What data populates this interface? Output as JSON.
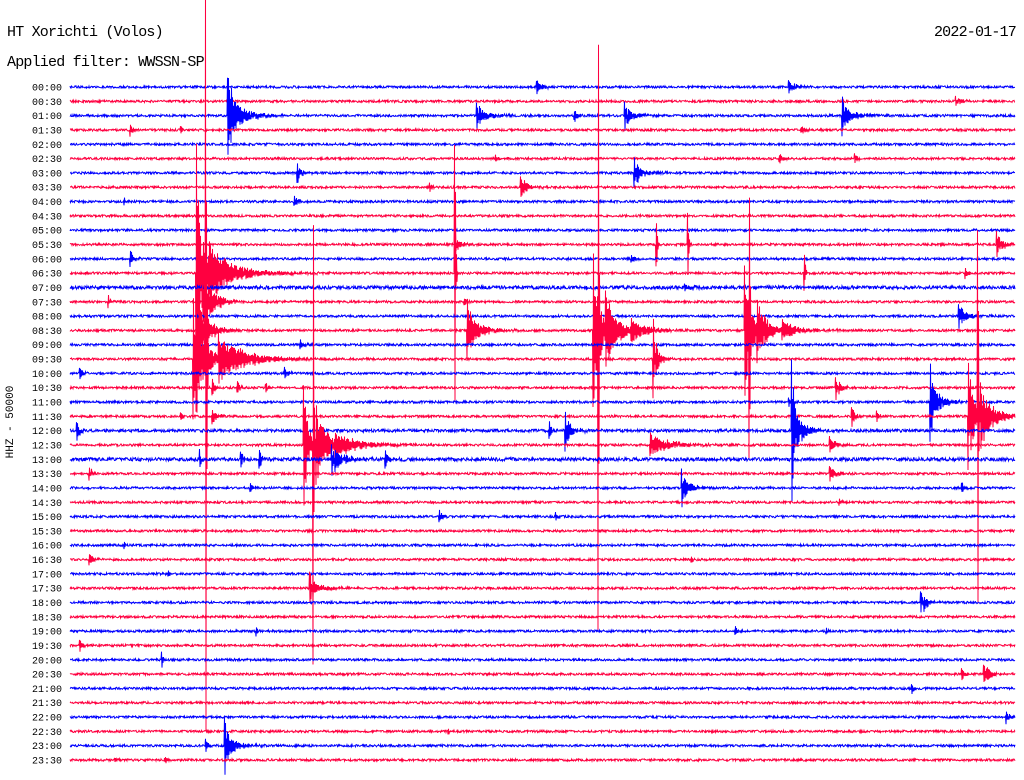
{
  "chart_data": {
    "type": "line",
    "title": "HT Xorichti (Volos)",
    "date": "2022-01-17",
    "subtitle": "Applied filter: WWSSN-SP",
    "ylabel": "HHZ - 50000",
    "xlabel": "",
    "xlim": [
      0,
      30
    ],
    "grid": false,
    "colors": [
      "#0000ff",
      "#ff0040"
    ],
    "noise": 0.08,
    "traces": [
      {
        "label": "00:00",
        "events": [
          [
            14.8,
            0.45,
            0.5
          ],
          [
            22.8,
            0.45,
            0.6
          ]
        ]
      },
      {
        "label": "00:30",
        "events": [
          [
            28.1,
            0.3,
            0.6
          ]
        ]
      },
      {
        "label": "01:00",
        "events": [
          [
            5.0,
            2.7,
            0.3
          ],
          [
            5.1,
            1.0,
            1.6
          ],
          [
            12.9,
            0.9,
            0.2
          ],
          [
            13.0,
            0.4,
            1.2
          ],
          [
            16.0,
            0.35,
            0.4
          ],
          [
            17.6,
            1.05,
            0.2
          ],
          [
            17.7,
            0.4,
            1.0
          ],
          [
            24.5,
            1.4,
            0.2
          ],
          [
            24.6,
            0.5,
            1.2
          ]
        ]
      },
      {
        "label": "01:30",
        "events": [
          [
            1.9,
            0.4,
            0.3
          ],
          [
            3.5,
            0.2,
            0.2
          ],
          [
            23.2,
            0.25,
            0.5
          ]
        ]
      },
      {
        "label": "02:00",
        "events": []
      },
      {
        "label": "02:30",
        "events": [
          [
            13.5,
            0.2,
            0.2
          ],
          [
            22.5,
            0.3,
            0.6
          ],
          [
            24.9,
            0.3,
            0.3
          ]
        ]
      },
      {
        "label": "03:00",
        "events": [
          [
            7.2,
            0.7,
            0.4
          ],
          [
            17.9,
            1.05,
            0.2
          ],
          [
            18.0,
            0.4,
            1.0
          ]
        ]
      },
      {
        "label": "03:30",
        "events": [
          [
            11.4,
            0.35,
            0.2
          ],
          [
            14.3,
            0.7,
            0.3
          ],
          [
            14.4,
            0.3,
            1.0
          ]
        ]
      },
      {
        "label": "04:00",
        "events": [
          [
            1.7,
            0.2,
            0.1
          ],
          [
            7.1,
            0.35,
            0.4
          ]
        ]
      },
      {
        "label": "04:30",
        "events": []
      },
      {
        "label": "05:00",
        "events": []
      },
      {
        "label": "05:30",
        "events": [
          [
            12.2,
            1.0,
            0.1
          ],
          [
            12.3,
            0.3,
            0.6
          ],
          [
            18.6,
            1.5,
            0.08
          ],
          [
            19.6,
            2.2,
            0.08
          ],
          [
            29.4,
            0.9,
            0.6
          ]
        ]
      },
      {
        "label": "06:00",
        "events": [
          [
            1.9,
            0.5,
            0.3
          ],
          [
            17.8,
            0.25,
            0.5
          ]
        ]
      },
      {
        "label": "06:30",
        "events": [
          [
            4.0,
            9.0,
            0.12
          ],
          [
            4.05,
            3.5,
            1.0
          ],
          [
            4.4,
            1.3,
            2.8
          ],
          [
            12.2,
            9.0,
            0.06
          ],
          [
            23.3,
            1.2,
            0.08
          ],
          [
            28.4,
            0.4,
            0.3
          ]
        ]
      },
      {
        "label": "07:00",
        "noise": 0.12,
        "events": [
          [
            19.5,
            0.25,
            1.0
          ]
        ]
      },
      {
        "label": "07:30",
        "events": [
          [
            1.2,
            0.4,
            0.2
          ],
          [
            4.2,
            2.0,
            1.0
          ],
          [
            12.5,
            0.25,
            0.3
          ]
        ]
      },
      {
        "label": "08:00",
        "events": [
          [
            28.2,
            0.85,
            0.2
          ],
          [
            28.3,
            0.35,
            0.8
          ]
        ]
      },
      {
        "label": "08:30",
        "events": [
          [
            4.1,
            2.0,
            1.0
          ],
          [
            12.6,
            2.2,
            0.25
          ],
          [
            12.7,
            0.8,
            1.3
          ],
          [
            16.75,
            19.0,
            0.05
          ],
          [
            16.6,
            5.3,
            0.6
          ],
          [
            17.0,
            2.0,
            1.2
          ],
          [
            17.8,
            0.6,
            1.5
          ],
          [
            21.55,
            8.0,
            0.06
          ],
          [
            21.4,
            4.5,
            0.6
          ],
          [
            21.8,
            1.8,
            1.0
          ],
          [
            22.6,
            0.6,
            1.5
          ]
        ]
      },
      {
        "label": "09:00",
        "events": [
          [
            7.3,
            0.35,
            0.3
          ]
        ]
      },
      {
        "label": "09:30",
        "events": [
          [
            3.9,
            4.2,
            0.2
          ],
          [
            4.0,
            3.0,
            1.0
          ],
          [
            4.3,
            25.0,
            0.05
          ],
          [
            4.7,
            1.5,
            2.6
          ],
          [
            18.5,
            2.8,
            0.12
          ],
          [
            18.6,
            0.8,
            0.5
          ]
        ]
      },
      {
        "label": "10:00",
        "events": [
          [
            0.3,
            0.45,
            0.3
          ],
          [
            6.8,
            0.4,
            0.3
          ]
        ]
      },
      {
        "label": "10:30",
        "events": [
          [
            4.5,
            0.6,
            0.2
          ],
          [
            5.3,
            0.4,
            0.2
          ],
          [
            6.2,
            0.3,
            0.2
          ],
          [
            24.3,
            0.8,
            0.2
          ],
          [
            24.4,
            0.3,
            0.6
          ]
        ]
      },
      {
        "label": "11:00",
        "events": [
          [
            22.8,
            0.3,
            0.3
          ],
          [
            27.3,
            2.7,
            0.12
          ],
          [
            27.35,
            1.1,
            1.0
          ]
        ]
      },
      {
        "label": "11:30",
        "events": [
          [
            3.5,
            0.3,
            0.2
          ],
          [
            4.5,
            0.5,
            0.5
          ],
          [
            24.8,
            0.7,
            0.3
          ],
          [
            25.6,
            0.4,
            0.2
          ],
          [
            28.8,
            12.5,
            0.05
          ],
          [
            28.5,
            3.8,
            0.5
          ],
          [
            28.9,
            2.0,
            1.2
          ]
        ]
      },
      {
        "label": "12:00",
        "noise": 0.1,
        "events": [
          [
            0.2,
            0.6,
            0.3
          ],
          [
            15.2,
            0.6,
            0.2
          ],
          [
            15.7,
            1.4,
            0.15
          ],
          [
            15.8,
            0.5,
            0.8
          ],
          [
            22.9,
            5.0,
            0.08
          ],
          [
            22.95,
            2.0,
            0.8
          ]
        ]
      },
      {
        "label": "12:30",
        "events": [
          [
            7.7,
            15.0,
            0.05
          ],
          [
            7.4,
            4.2,
            0.4
          ],
          [
            7.8,
            2.5,
            1.0
          ],
          [
            8.4,
            0.7,
            2.5
          ],
          [
            18.4,
            0.8,
            1.8
          ],
          [
            24.1,
            0.55,
            0.6
          ]
        ]
      },
      {
        "label": "13:00",
        "noise": 0.12,
        "events": [
          [
            4.1,
            0.6,
            0.2
          ],
          [
            5.4,
            0.6,
            0.2
          ],
          [
            6.0,
            0.6,
            0.2
          ],
          [
            8.3,
            1.05,
            0.3
          ],
          [
            8.4,
            0.5,
            1.5
          ],
          [
            10.0,
            0.55,
            0.4
          ]
        ]
      },
      {
        "label": "13:30",
        "events": [
          [
            0.6,
            0.45,
            0.3
          ],
          [
            24.1,
            0.55,
            0.5
          ]
        ]
      },
      {
        "label": "14:00",
        "events": [
          [
            5.7,
            0.35,
            0.3
          ],
          [
            19.4,
            1.4,
            0.15
          ],
          [
            19.5,
            0.5,
            1.0
          ],
          [
            28.3,
            0.35,
            0.2
          ]
        ]
      },
      {
        "label": "14:30",
        "events": [
          [
            24.4,
            0.2,
            0.2
          ]
        ]
      },
      {
        "label": "15:00",
        "events": [
          [
            11.7,
            0.4,
            0.3
          ],
          [
            15.4,
            0.3,
            0.2
          ]
        ]
      },
      {
        "label": "15:30",
        "events": []
      },
      {
        "label": "16:00",
        "events": [
          [
            1.7,
            0.2,
            0.1
          ]
        ]
      },
      {
        "label": "16:30",
        "events": [
          [
            0.6,
            0.4,
            0.3
          ],
          [
            19.7,
            0.25,
            0.2
          ]
        ]
      },
      {
        "label": "17:00",
        "events": [
          [
            3.1,
            0.2,
            0.2
          ]
        ]
      },
      {
        "label": "17:30",
        "events": [
          [
            7.6,
            1.1,
            0.15
          ],
          [
            7.7,
            0.4,
            1.2
          ]
        ]
      },
      {
        "label": "18:00",
        "events": [
          [
            27.0,
            0.7,
            0.2
          ],
          [
            27.1,
            0.4,
            0.6
          ]
        ]
      },
      {
        "label": "18:30",
        "events": []
      },
      {
        "label": "19:00",
        "events": [
          [
            5.9,
            0.3,
            0.1
          ],
          [
            21.1,
            0.3,
            0.3
          ],
          [
            24.0,
            0.2,
            0.1
          ]
        ]
      },
      {
        "label": "19:30",
        "events": [
          [
            0.3,
            0.4,
            0.2
          ]
        ]
      },
      {
        "label": "20:00",
        "events": [
          [
            2.9,
            0.55,
            0.1
          ]
        ]
      },
      {
        "label": "20:30",
        "events": [
          [
            28.3,
            0.35,
            0.3
          ],
          [
            29.0,
            0.6,
            0.3
          ],
          [
            29.1,
            0.3,
            0.6
          ]
        ]
      },
      {
        "label": "21:00",
        "events": [
          [
            26.7,
            0.35,
            0.2
          ]
        ]
      },
      {
        "label": "21:30",
        "events": []
      },
      {
        "label": "22:00",
        "events": [
          [
            29.7,
            0.45,
            0.3
          ]
        ]
      },
      {
        "label": "22:30",
        "events": [
          [
            12.0,
            0.15,
            0.1
          ]
        ]
      },
      {
        "label": "23:00",
        "events": [
          [
            4.3,
            0.5,
            0.2
          ],
          [
            4.9,
            2.0,
            0.15
          ],
          [
            5.0,
            0.7,
            1.0
          ]
        ]
      },
      {
        "label": "23:30",
        "events": [
          [
            1.4,
            0.2,
            0.3
          ],
          [
            3.0,
            0.2,
            0.3
          ]
        ]
      }
    ]
  }
}
